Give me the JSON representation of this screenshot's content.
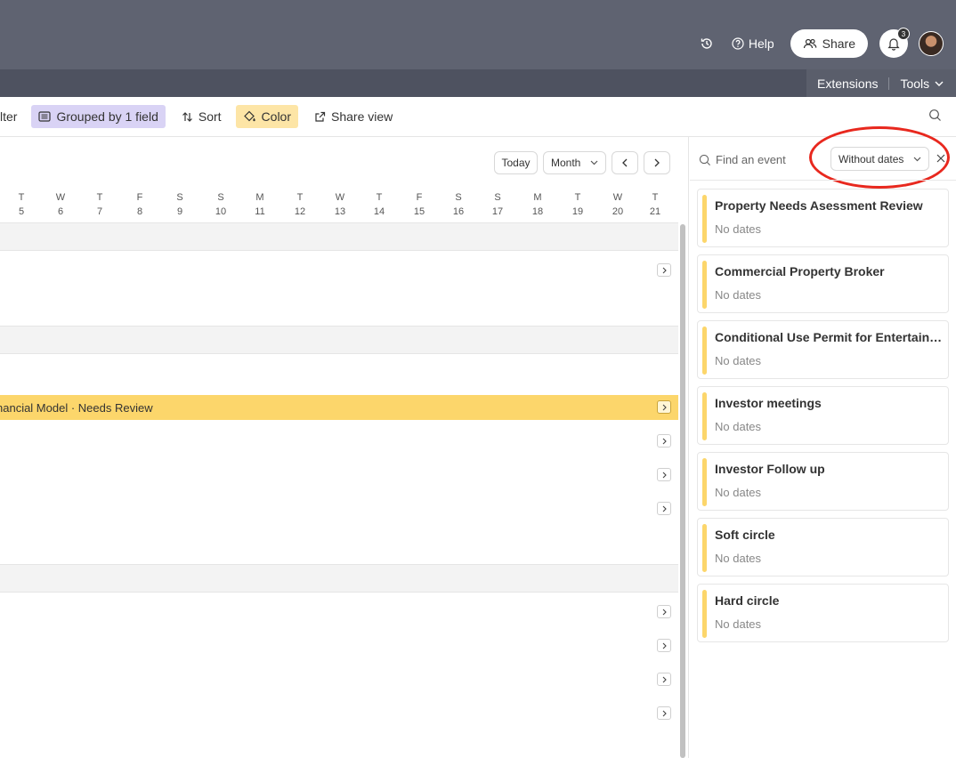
{
  "header": {
    "help_label": "Help",
    "share_label": "Share",
    "notification_count": "3"
  },
  "subbar": {
    "extensions_label": "Extensions",
    "tools_label": "Tools"
  },
  "toolbar": {
    "filter_label": "lter",
    "grouped_label": "Grouped by 1 field",
    "sort_label": "Sort",
    "color_label": "Color",
    "share_view_label": "Share view"
  },
  "calendar": {
    "today_label": "Today",
    "period_label": "Month",
    "days": [
      {
        "dow": "T",
        "num": "5"
      },
      {
        "dow": "W",
        "num": "6"
      },
      {
        "dow": "T",
        "num": "7"
      },
      {
        "dow": "F",
        "num": "8"
      },
      {
        "dow": "S",
        "num": "9"
      },
      {
        "dow": "S",
        "num": "10"
      },
      {
        "dow": "M",
        "num": "11"
      },
      {
        "dow": "T",
        "num": "12"
      },
      {
        "dow": "W",
        "num": "13"
      },
      {
        "dow": "T",
        "num": "14"
      },
      {
        "dow": "F",
        "num": "15"
      },
      {
        "dow": "S",
        "num": "16"
      },
      {
        "dow": "S",
        "num": "17"
      },
      {
        "dow": "M",
        "num": "18"
      },
      {
        "dow": "T",
        "num": "19"
      },
      {
        "dow": "W",
        "num": "20"
      },
      {
        "dow": "T",
        "num": "21"
      }
    ],
    "event_bar_label": "nancial Model · Needs Review",
    "colors": {
      "event": "#fcd66b",
      "grouped": "#d9d3f5",
      "color_btn": "#fde5a6"
    }
  },
  "panel": {
    "search_placeholder": "Find an event",
    "filter_label": "Without dates",
    "events": [
      {
        "title": "Property Needs Asessment Review",
        "sub": "No dates"
      },
      {
        "title": "Commercial Property Broker",
        "sub": "No dates"
      },
      {
        "title": "Conditional Use Permit for Entertainment",
        "sub": "No dates"
      },
      {
        "title": "Investor meetings",
        "sub": "No dates"
      },
      {
        "title": "Investor Follow up",
        "sub": "No dates"
      },
      {
        "title": "Soft circle",
        "sub": "No dates"
      },
      {
        "title": "Hard circle",
        "sub": "No dates"
      }
    ]
  }
}
